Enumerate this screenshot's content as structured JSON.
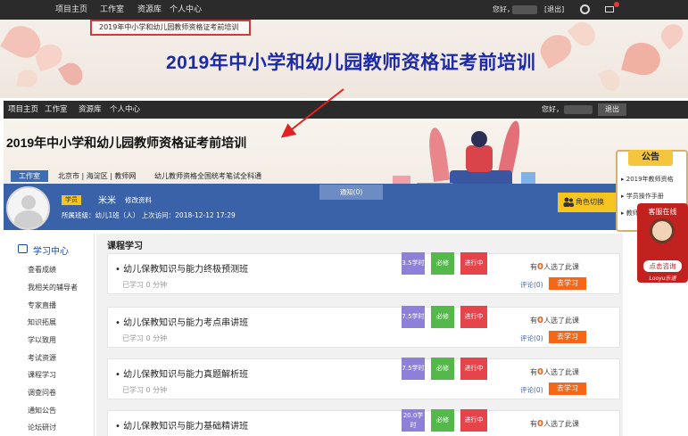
{
  "top_nav": {
    "items": [
      "项目主页",
      "工作室",
      "资源库",
      "个人中心"
    ],
    "greeting": "您好，",
    "exit": "[退出]"
  },
  "zoom": {
    "breadcrumb": "2019年中小学和幼儿园教师资格证考前培训",
    "big_title": "2019年中小学和幼儿园教师资格证考前培训"
  },
  "main_nav": {
    "items": [
      "项目主页",
      "工作室",
      "资源库",
      "个人中心"
    ],
    "greeting": "您好，",
    "exit": "退出"
  },
  "banner": {
    "title": "2019年中小学和幼儿园教师资格证考前培训",
    "workroom": "工作室",
    "org_path": "北京市 | 海淀区 | 教师网",
    "exam_name": "幼儿教师资格全国统考笔试全科通"
  },
  "profile": {
    "role": "学员",
    "name": "米米",
    "edit": "修改资料",
    "class_info": "所属班级：幼儿1班（人） 上次访问：2018-12-12 17:29",
    "notify": "通知(0)",
    "role_switch": "角色切换"
  },
  "sidebar": {
    "header": "学习中心",
    "items": [
      "查看成绩",
      "我相关的辅导者",
      "专家直播",
      "知识拓展",
      "学以致用",
      "考试资源",
      "课程学习",
      "调查问卷",
      "通知公告",
      "论坛研讨"
    ]
  },
  "content": {
    "section_title": "课程学习",
    "courses": [
      {
        "name": "• 幼儿保教知识与能力终极预测班",
        "hours": "3.5学时",
        "required": "必修",
        "status": "进行中",
        "studied": "已学习 0 分钟",
        "selected_prefix": "有",
        "selected_count": "0",
        "selected_suffix": "人选了此课",
        "review": "评论(0)",
        "action": "去学习"
      },
      {
        "name": "• 幼儿保教知识与能力考点串讲班",
        "hours": "7.5学时",
        "required": "必修",
        "status": "进行中",
        "studied": "已学习 0 分钟",
        "selected_prefix": "有",
        "selected_count": "0",
        "selected_suffix": "人选了此课",
        "review": "评论(0)",
        "action": "去学习"
      },
      {
        "name": "• 幼儿保教知识与能力真题解析班",
        "hours": "7.5学时",
        "required": "必修",
        "status": "进行中",
        "studied": "已学习 0 分钟",
        "selected_prefix": "有",
        "selected_count": "0",
        "selected_suffix": "人选了此课",
        "review": "评论(0)",
        "action": "去学习"
      },
      {
        "name": "• 幼儿保教知识与能力基础精讲班",
        "hours": "20.0学时",
        "required": "必修",
        "status": "进行中",
        "studied": "",
        "selected_prefix": "有",
        "selected_count": "0",
        "selected_suffix": "人选了此课",
        "review": "",
        "action": ""
      }
    ]
  },
  "notice": {
    "title": "公告",
    "items": [
      "▸ 2019年教师资格",
      "▸ 学员操作手册",
      "▸ 教师"
    ]
  },
  "consult": {
    "title": "客服在线",
    "button": "点击咨询",
    "brand": "Looyu乐语"
  },
  "colors": {
    "nav_bg": "#2b2b2b",
    "profile_bar": "#3a62a8",
    "title_blue": "#1c2aa8",
    "hours_tag": "#8e7fd8",
    "required_tag": "#54b84b",
    "progress_tag": "#e5454a",
    "study_button": "#f46717",
    "highlight_box": "#d03a3a"
  }
}
